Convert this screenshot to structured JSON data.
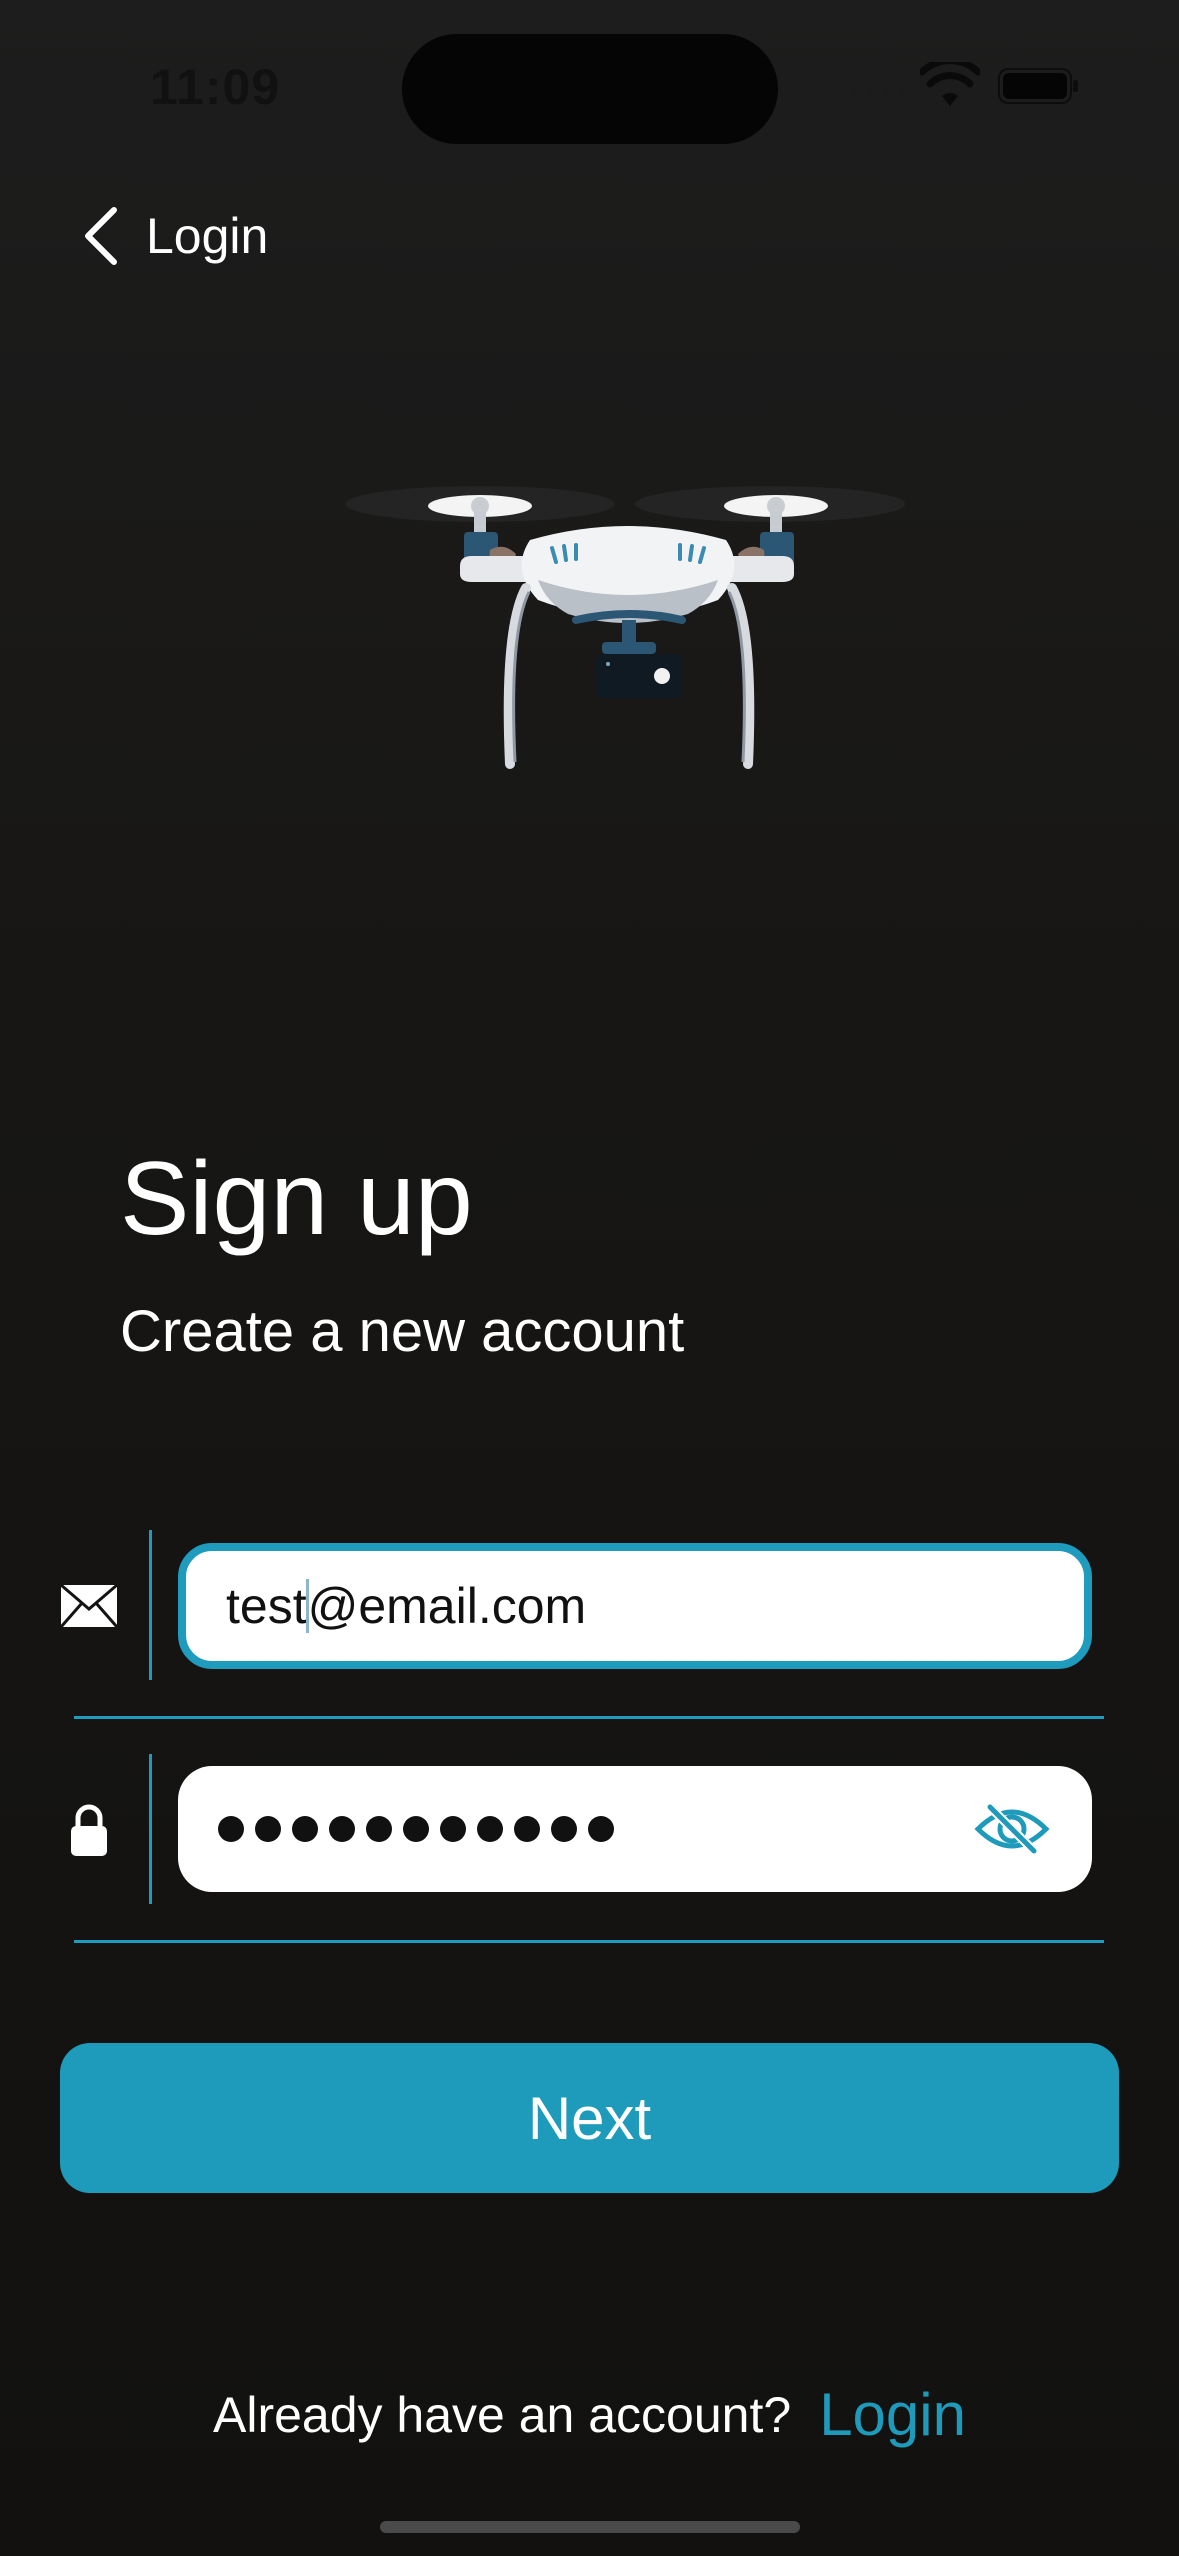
{
  "status_bar": {
    "time": "11:09"
  },
  "nav": {
    "back_label": "Login"
  },
  "header": {
    "title": "Sign up",
    "subtitle": "Create a new account"
  },
  "form": {
    "email": {
      "value_before_caret": "test",
      "value_after_caret": "@email.com",
      "focused": true,
      "icon": "envelope-icon"
    },
    "password": {
      "masked_length": 11,
      "icon": "lock-icon",
      "visibility_icon": "eye-slash-icon"
    }
  },
  "actions": {
    "next_label": "Next"
  },
  "footer": {
    "prompt": "Already have an account?",
    "login_link": "Login"
  },
  "colors": {
    "accent": "#1e9abb",
    "background": "#151413",
    "text": "#ffffff"
  }
}
